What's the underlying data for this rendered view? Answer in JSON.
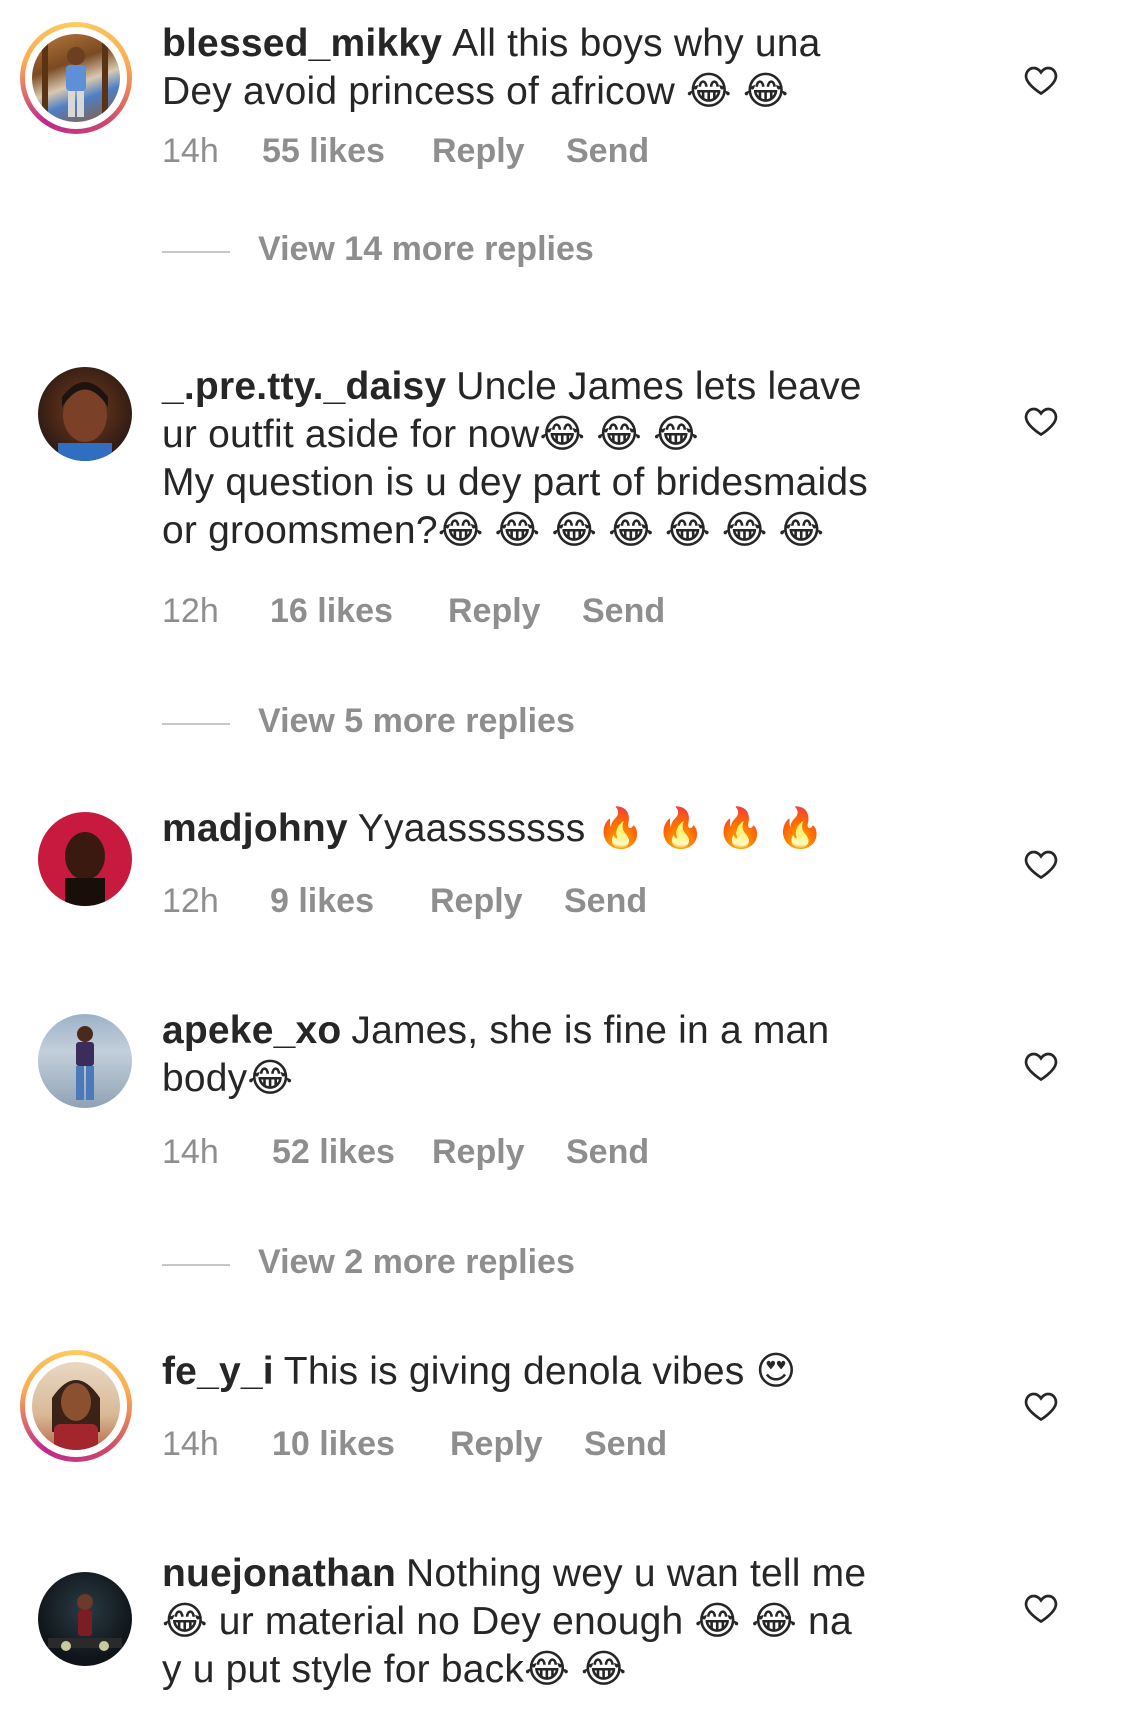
{
  "comments": [
    {
      "username": "blessed_mikky",
      "text": "All this boys why una\nDey avoid princess of africow 😂 😂",
      "time": "14h",
      "likes": "55 likes",
      "reply": "Reply",
      "send": "Send",
      "view_replies": "View 14 more replies",
      "story_ring": true
    },
    {
      "username": "_.pre.tty._daisy",
      "text": "Uncle James lets leave\nur outfit aside for now😂 😂 😂\nMy question is u dey part of bridesmaids\nor groomsmen?😂 😂 😂 😂 😂 😂 😂",
      "time": "12h",
      "likes": "16 likes",
      "reply": "Reply",
      "send": "Send",
      "view_replies": "View 5 more replies",
      "story_ring": false
    },
    {
      "username": "madjohny",
      "text": "Yyaasssssss 🔥 🔥 🔥 🔥",
      "time": "12h",
      "likes": "9 likes",
      "reply": "Reply",
      "send": "Send",
      "view_replies": "",
      "story_ring": false
    },
    {
      "username": "apeke_xo",
      "text": "James, she is fine in a man\nbody😂",
      "time": "14h",
      "likes": "52 likes",
      "reply": "Reply",
      "send": "Send",
      "view_replies": "View 2 more replies",
      "story_ring": false
    },
    {
      "username": "fe_y_i",
      "text": "This is giving denola vibes 😍",
      "time": "14h",
      "likes": "10 likes",
      "reply": "Reply",
      "send": "Send",
      "view_replies": "",
      "story_ring": true
    },
    {
      "username": "nuejonathan",
      "text": "Nothing wey u wan tell me\n😂 ur material no Dey enough 😂 😂 na\ny u put style for back😂 😂",
      "time": "",
      "likes": "",
      "reply": "",
      "send": "",
      "view_replies": "",
      "story_ring": false
    }
  ],
  "icons": {
    "like": "heart-outline-icon"
  },
  "colors": {
    "text": "#262626",
    "meta": "#8e8e8e",
    "ring_start": "#fccc63",
    "ring_mid": "#cd486b"
  }
}
